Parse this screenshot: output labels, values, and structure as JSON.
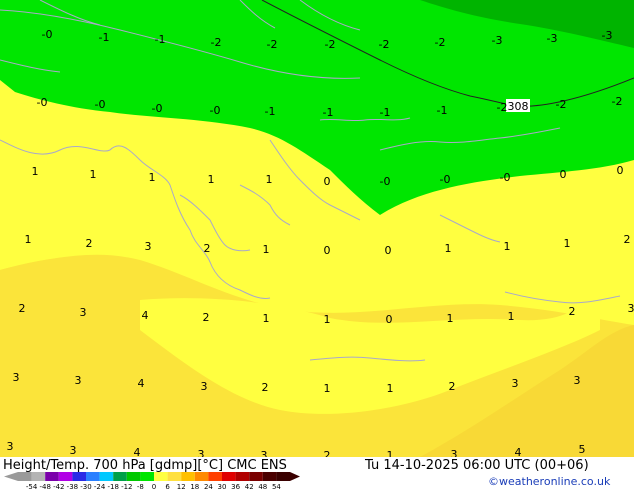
{
  "footer": {
    "title": "Height/Temp. 700 hPa [gdmp][°C] CMC ENS",
    "valid_time": "Tu 14-10-2025 06:00 UTC (00+06)",
    "credit": "©weatheronline.co.uk"
  },
  "colorbar": {
    "ticks": [
      "-54",
      "-48",
      "-42",
      "-38",
      "-30",
      "-24",
      "-18",
      "-12",
      "-8",
      "0",
      "6",
      "12",
      "18",
      "24",
      "30",
      "36",
      "42",
      "48",
      "54"
    ],
    "colors": [
      "#9a9a9a",
      "#b4b4b4",
      "#7a00aa",
      "#b100e6",
      "#2a2ae6",
      "#2a7fff",
      "#00c8ff",
      "#00a04a",
      "#00c800",
      "#00e600",
      "#ffff40",
      "#ffe040",
      "#ffc000",
      "#ff8a00",
      "#ff4000",
      "#e00000",
      "#b00000",
      "#7a0000",
      "#4a0000",
      "#3a0000"
    ]
  },
  "map": {
    "field_colors": {
      "green_dark": "#00b400",
      "green": "#00e600",
      "yellow": "#ffff40",
      "yellow_dark": "#fbe43a"
    },
    "contour_label": "308",
    "labels": [
      "-0",
      "-1",
      "-1",
      "-2",
      "-2",
      "-2",
      "-2",
      "-2",
      "-3",
      "-3",
      "-3",
      "-0",
      "-0",
      "-0",
      "-0",
      "-1",
      "-1",
      "-1",
      "-1",
      "-2",
      "-2",
      "-2",
      "1",
      "1",
      "1",
      "1",
      "1",
      "0",
      "-0",
      "-0",
      "-0",
      "0",
      "0",
      "1",
      "2",
      "3",
      "2",
      "1",
      "0",
      "0",
      "1",
      "1",
      "1",
      "2",
      "2",
      "3",
      "4",
      "2",
      "1",
      "1",
      "0",
      "1",
      "1",
      "2",
      "3",
      "3",
      "3",
      "4",
      "3",
      "2",
      "1",
      "1",
      "2",
      "3",
      "3",
      "3",
      "3",
      "4",
      "3",
      "3",
      "2",
      "1",
      "3",
      "4",
      "5"
    ]
  }
}
